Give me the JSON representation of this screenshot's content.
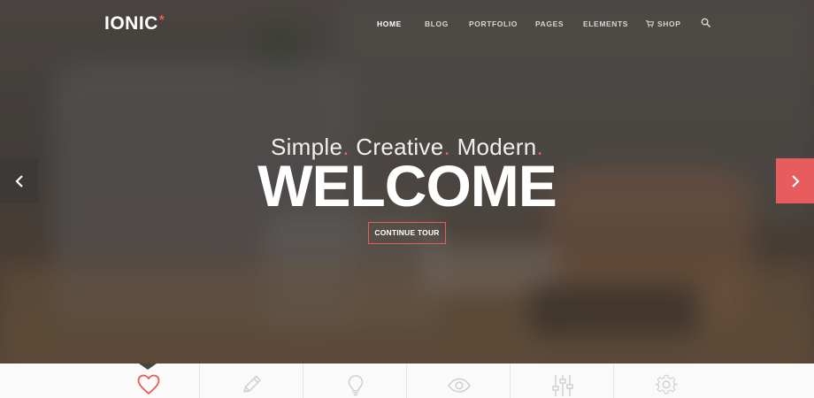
{
  "brand": {
    "name": "IONIC",
    "mark": "*"
  },
  "nav": {
    "items": [
      {
        "label": "HOME",
        "active": true
      },
      {
        "label": "BLOG",
        "active": false
      },
      {
        "label": "PORTFOLIO",
        "active": false
      },
      {
        "label": "PAGES",
        "active": false
      },
      {
        "label": "ELEMENTS",
        "active": false
      },
      {
        "label": "SHOP",
        "active": false,
        "icon": "cart-icon"
      }
    ],
    "search_icon": "search-icon"
  },
  "hero": {
    "tagline": {
      "words": [
        "Simple",
        "Creative",
        "Modern"
      ],
      "separator": "."
    },
    "headline": "WELCOME",
    "cta_label": "CONTINUE TOUR",
    "prev_icon": "chevron-left-icon",
    "next_icon": "chevron-right-icon"
  },
  "feature_tabs": [
    {
      "icon": "heart-icon",
      "active": true
    },
    {
      "icon": "pencil-icon",
      "active": false
    },
    {
      "icon": "lightbulb-icon",
      "active": false
    },
    {
      "icon": "eye-icon",
      "active": false
    },
    {
      "icon": "sliders-icon",
      "active": false
    },
    {
      "icon": "gear-icon",
      "active": false
    }
  ],
  "colors": {
    "accent": "#e75c5c",
    "text_light": "#ffffff",
    "nav_text": "#d8d4d1",
    "arrow_dark": "#3c3937",
    "tab_bg": "#fafafa",
    "icon_inactive": "#cfcfcf"
  }
}
